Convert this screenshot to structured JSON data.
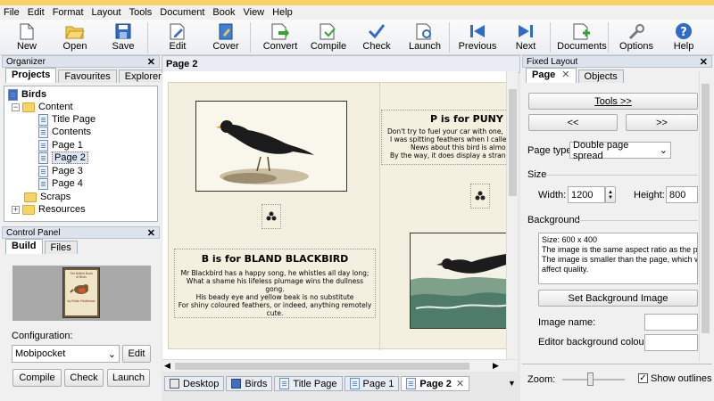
{
  "menu": [
    "File",
    "Edit",
    "Format",
    "Layout",
    "Tools",
    "Document",
    "Book",
    "View",
    "Help"
  ],
  "toolbar": [
    {
      "label": "New",
      "icon": "new-icon"
    },
    {
      "label": "Open",
      "icon": "open-folder-icon"
    },
    {
      "label": "Save",
      "icon": "save-icon"
    },
    {
      "label": "Edit",
      "icon": "edit-icon"
    },
    {
      "label": "Cover",
      "icon": "cover-icon"
    },
    {
      "label": "Convert",
      "icon": "convert-icon"
    },
    {
      "label": "Compile",
      "icon": "compile-icon"
    },
    {
      "label": "Check",
      "icon": "check-icon"
    },
    {
      "label": "Launch",
      "icon": "launch-icon"
    },
    {
      "label": "Previous",
      "icon": "previous-icon"
    },
    {
      "label": "Next",
      "icon": "next-icon"
    },
    {
      "label": "Documents",
      "icon": "documents-icon"
    },
    {
      "label": "Options",
      "icon": "options-icon"
    },
    {
      "label": "Help",
      "icon": "help-icon"
    }
  ],
  "organizer": {
    "title": "Organizer",
    "tabs": [
      "Projects",
      "Favourites",
      "Explorer"
    ],
    "tree": {
      "root": "Birds",
      "content": "Content",
      "pages": [
        "Title Page",
        "Contents",
        "Page 1",
        "Page 2",
        "Page 3",
        "Page 4"
      ],
      "scraps": "Scraps",
      "resources": "Resources"
    }
  },
  "control_panel": {
    "title": "Control Panel",
    "tabs": [
      "Build",
      "Files"
    ],
    "cover_text": [
      "The British Book",
      "of Birds",
      "",
      "by Robin Redbreast"
    ],
    "config_label": "Configuration:",
    "config_value": "Mobipocket",
    "edit_btn": "Edit",
    "compile_btn": "Compile",
    "check_btn": "Check",
    "launch_btn": "Launch"
  },
  "editor": {
    "tab_title": "Page 2",
    "left_title": "B is for BLAND BLACKBIRD",
    "left_body": [
      "Mr Blackbird has a happy song, he whistles all day long;",
      "What a shame his lifeless plumage wins the dullness gong.",
      "His beady eye and yellow beak is no substitute",
      "For shiny coloured feathers, or indeed, anything remotely",
      "cute."
    ],
    "right_title": "P is for PUNY PETREL",
    "right_body": [
      "Don't try to fuel your car with one, I tr",
      "I was spitting feathers when I called t",
      "News about this bird is almost al",
      "By the way, it does display a strange"
    ]
  },
  "doc_tabs": [
    "Desktop",
    "Birds",
    "Title Page",
    "Page 1",
    "Page 2"
  ],
  "fixed_layout": {
    "title": "Fixed Layout",
    "tabs": [
      "Page",
      "Objects"
    ],
    "tools_btn": "Tools >>",
    "prev_btn": "<<",
    "next_btn": ">>",
    "page_type_label": "Page type:",
    "page_type": "Double page spread",
    "size_header": "Size",
    "width_label": "Width:",
    "width": "1200",
    "height_label": "Height:",
    "height": "800",
    "background_header": "Background",
    "bg_info": [
      "Size: 600 x 400",
      "The image is the same aspect ratio as the pa",
      "The image is smaller than the page, which wi",
      "affect quality."
    ],
    "set_bg_btn": "Set Background Image",
    "image_name_label": "Image name:",
    "editor_bg_label": "Editor background colour:",
    "zoom_label": "Zoom:",
    "show_outlines": "Show outlines"
  }
}
